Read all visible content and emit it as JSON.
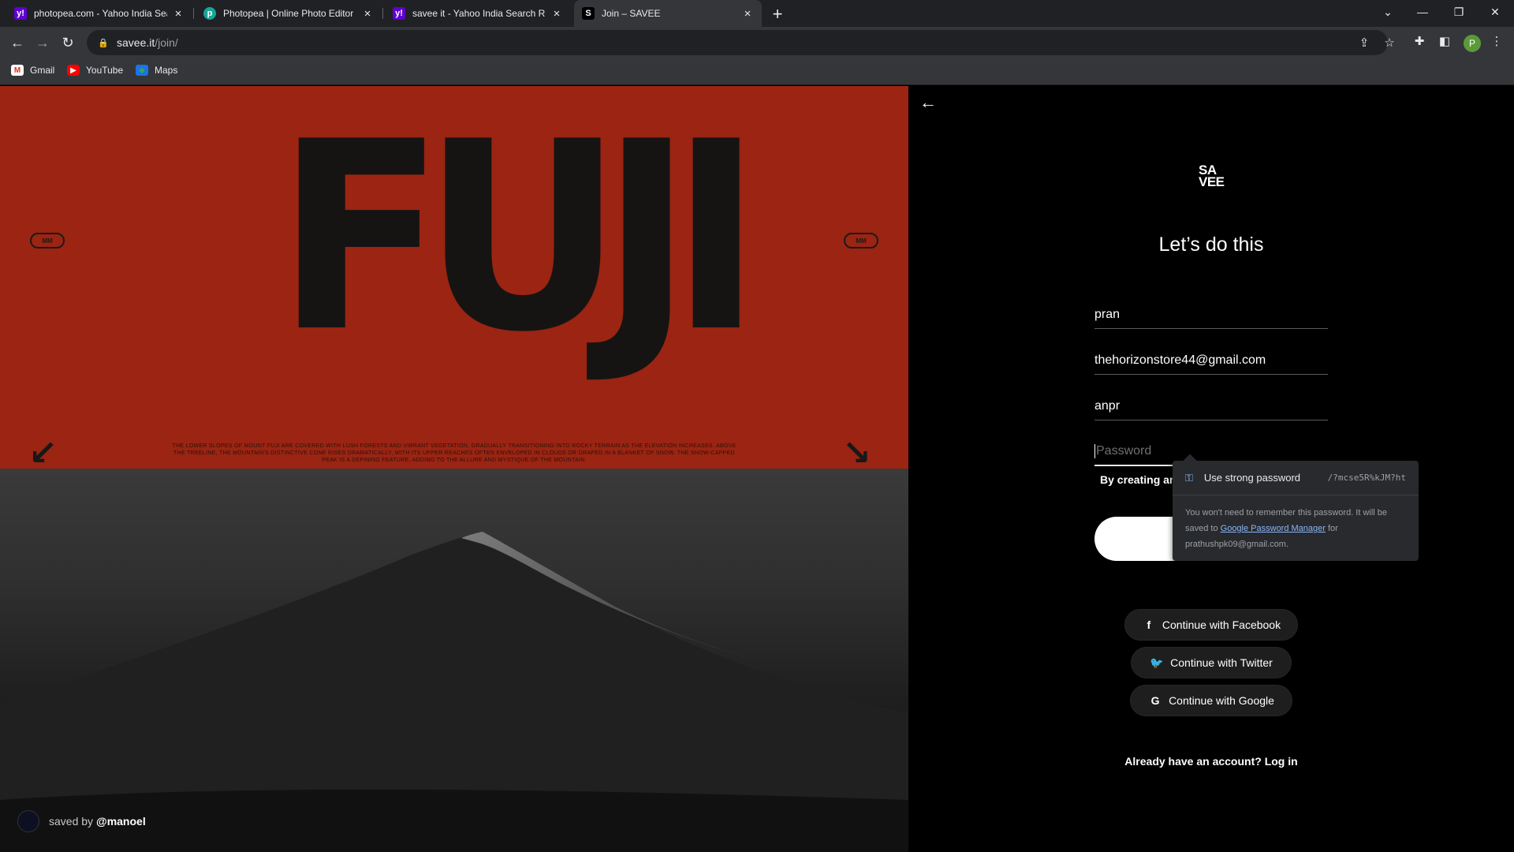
{
  "browser": {
    "tabs": [
      {
        "title": "photopea.com - Yahoo India Sea",
        "favicon": "yahoo-icon",
        "active": false
      },
      {
        "title": "Photopea | Online Photo Editor",
        "favicon": "photopea-icon",
        "active": false
      },
      {
        "title": "savee it - Yahoo India Search Res",
        "favicon": "yahoo-icon",
        "active": false
      },
      {
        "title": "Join – SAVEE",
        "favicon": "savee-icon",
        "active": true
      }
    ],
    "address": {
      "host": "savee.it",
      "path": "/join/"
    },
    "profile_initial": "P",
    "bookmarks": [
      {
        "label": "Gmail",
        "icon": "gmail-icon"
      },
      {
        "label": "YouTube",
        "icon": "youtube-icon"
      },
      {
        "label": "Maps",
        "icon": "maps-icon"
      }
    ]
  },
  "art": {
    "headline": "FUJI",
    "pill_left": "MM",
    "pill_right": "MM",
    "body_text": "THE LOWER SLOPES OF MOUNT FUJI ARE COVERED WITH LUSH FORESTS AND VIBRANT VEGETATION, GRADUALLY TRANSITIONING INTO ROCKY TERRAIN AS THE ELEVATION INCREASES. ABOVE THE TREELINE, THE MOUNTAIN'S DISTINCTIVE CONE RISES DRAMATICALLY, WITH ITS UPPER REACHES OFTEN ENVELOPED IN CLOUDS OR DRAPED IN A BLANKET OF SNOW. THE SNOW-CAPPED PEAK IS A DEFINING FEATURE, ADDING TO THE ALLURE AND MYSTIQUE OF THE MOUNTAIN.",
    "saved_by_prefix": "saved by",
    "saved_by_user": "@manoel"
  },
  "form": {
    "logo": "SA\nVEE",
    "heading": "Let’s do this",
    "name_value": "pran",
    "email_value": "thehorizonstore44@gmail.com",
    "username_value": "anpr",
    "password_placeholder": "Password",
    "terms_text": "By creating an"
  },
  "password_popup": {
    "title": "Use strong password",
    "suggested": "/?mcse5R%kJM?ht",
    "note_before": "You won't need to remember this password. It will be saved to ",
    "note_link": "Google Password Manager",
    "note_after": " for prathushpk09@gmail.com."
  },
  "social": {
    "facebook": "Continue with Facebook",
    "twitter": "Continue with Twitter",
    "google": "Continue with Google"
  },
  "login_prompt": "Already have an account? Log in"
}
